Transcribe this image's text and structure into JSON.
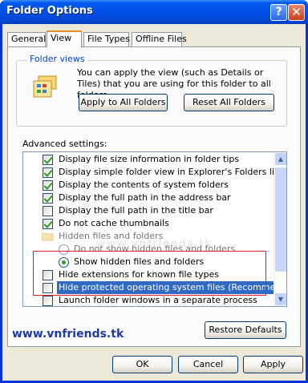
{
  "window": {
    "title": "Folder Options"
  },
  "title_buttons": {
    "help": "?",
    "close": "✕"
  },
  "tabs": [
    {
      "label": "General"
    },
    {
      "label": "View"
    },
    {
      "label": "File Types"
    },
    {
      "label": "Offline Files"
    }
  ],
  "active_tab": "View",
  "folder_views": {
    "title": "Folder views",
    "description": "You can apply the view (such as Details or Tiles) that you are using for this folder to all folders.",
    "apply_all_label": "Apply to All Folders",
    "reset_all_label": "Reset All Folders"
  },
  "advanced": {
    "label": "Advanced settings:",
    "items": [
      {
        "kind": "checkbox",
        "checked": true,
        "label": "Display file size information in folder tips"
      },
      {
        "kind": "checkbox",
        "checked": true,
        "label": "Display simple folder view in Explorer's Folders list"
      },
      {
        "kind": "checkbox",
        "checked": true,
        "label": "Display the contents of system folders"
      },
      {
        "kind": "checkbox",
        "checked": true,
        "label": "Display the full path in the address bar"
      },
      {
        "kind": "checkbox",
        "checked": false,
        "label": "Display the full path in the title bar"
      },
      {
        "kind": "checkbox",
        "checked": true,
        "label": "Do not cache thumbnails"
      },
      {
        "kind": "folder",
        "label": "Hidden files and folders"
      },
      {
        "kind": "radio",
        "checked": false,
        "label": "Do not show hidden files and folders"
      },
      {
        "kind": "radio",
        "checked": true,
        "label": "Show hidden files and folders"
      },
      {
        "kind": "checkbox",
        "checked": false,
        "label": "Hide extensions for known file types"
      },
      {
        "kind": "checkbox",
        "checked": false,
        "label": "Hide protected operating system files (Recommended)",
        "selected": true
      },
      {
        "kind": "checkbox",
        "checked": false,
        "label": "Launch folder windows in a separate process"
      }
    ],
    "restore_defaults_label": "Restore Defaults"
  },
  "watermark": "www.vnfriends.tk",
  "site_link": "www.vnfriends.tk",
  "dialog_buttons": {
    "ok": "OK",
    "cancel": "Cancel",
    "apply": "Apply"
  },
  "colors": {
    "titlebar": "#0050e6",
    "selection": "#316ac5",
    "highlight_box": "#e02020",
    "link": "#1f3aa6"
  }
}
